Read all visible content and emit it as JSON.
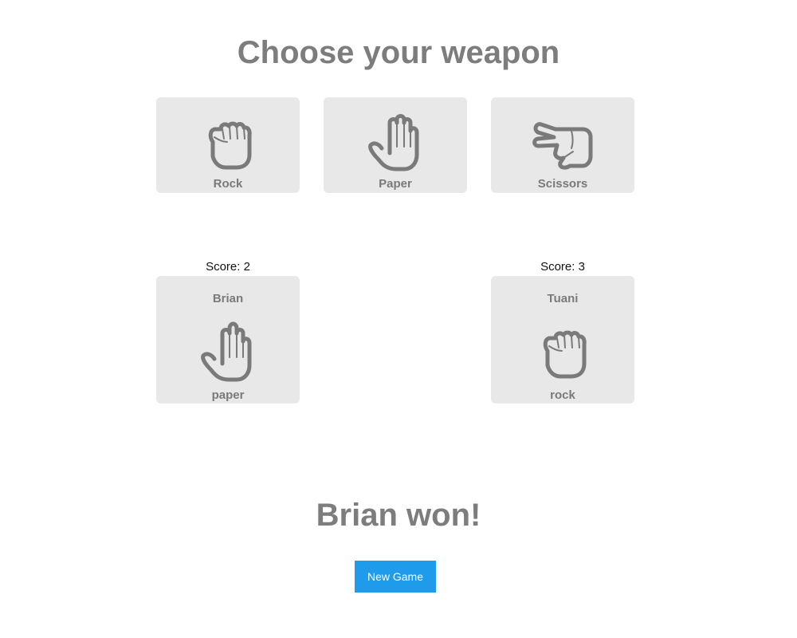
{
  "heading": "Choose your weapon",
  "weapons": [
    {
      "label": "Rock",
      "icon": "fist-icon"
    },
    {
      "label": "Paper",
      "icon": "open-hand-icon"
    },
    {
      "label": "Scissors",
      "icon": "peace-hand-icon"
    }
  ],
  "players": {
    "left": {
      "score_text": "Score: 2",
      "name": "Brian",
      "choice": "paper",
      "icon": "open-hand-icon"
    },
    "right": {
      "score_text": "Score: 3",
      "name": "Tuani",
      "choice": "rock",
      "icon": "fist-icon"
    }
  },
  "result": "Brian won!",
  "new_game_label": "New Game",
  "colors": {
    "card_background": "#e8e8e8",
    "text_gray": "#7a7a7a",
    "button_blue": "#1e9bea"
  }
}
